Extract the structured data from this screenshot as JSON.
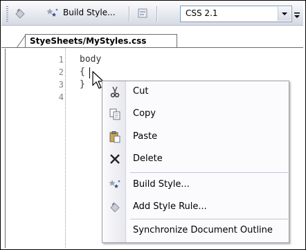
{
  "toolbar": {
    "build_style_label": "Build Style...",
    "css_version_value": "CSS 2.1"
  },
  "tab": {
    "label": "StyeSheets/MyStyles.css"
  },
  "editor": {
    "line_numbers": [
      "1",
      "2",
      "3",
      "4"
    ],
    "lines": [
      "body",
      "{",
      "}",
      ""
    ]
  },
  "context_menu": {
    "items": [
      {
        "label": "Cut",
        "icon": "scissors-icon"
      },
      {
        "label": "Copy",
        "icon": "copy-icon"
      },
      {
        "label": "Paste",
        "icon": "paste-icon"
      },
      {
        "label": "Delete",
        "icon": "delete-x-icon"
      },
      {
        "label": "Build Style...",
        "icon": "build-style-icon"
      },
      {
        "label": "Add Style Rule...",
        "icon": "add-style-rule-icon"
      },
      {
        "label": "Synchronize Document Outline",
        "icon": ""
      }
    ]
  },
  "colors": {
    "line_number": "#808080",
    "code_text": "#333333",
    "menu_border": "#9a9aa6"
  }
}
